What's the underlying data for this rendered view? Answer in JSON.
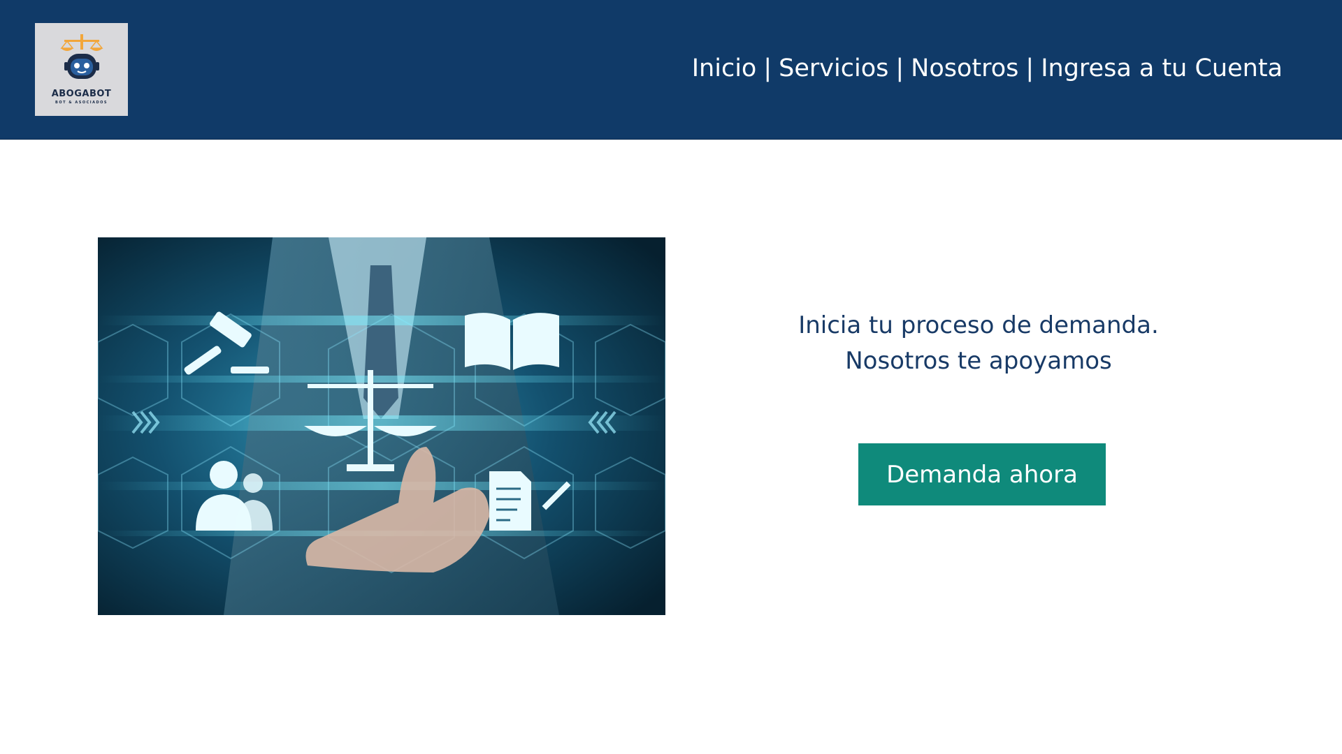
{
  "header": {
    "logo": {
      "title": "ABOGABOT",
      "subtitle": "BOT & ASOCIADOS"
    },
    "nav": {
      "items": [
        "Inicio",
        "Servicios",
        "Nosotros",
        "Ingresa a tu Cuenta"
      ],
      "separator": "|"
    }
  },
  "hero": {
    "image_icon": "legal-technology-illustration",
    "tagline_line1": "Inicia tu proceso de demanda.",
    "tagline_line2": "Nosotros te apoyamos",
    "cta_label": "Demanda ahora"
  },
  "colors": {
    "header_bg": "#103a68",
    "tagline": "#183a66",
    "cta_bg": "#0f8a7b"
  }
}
